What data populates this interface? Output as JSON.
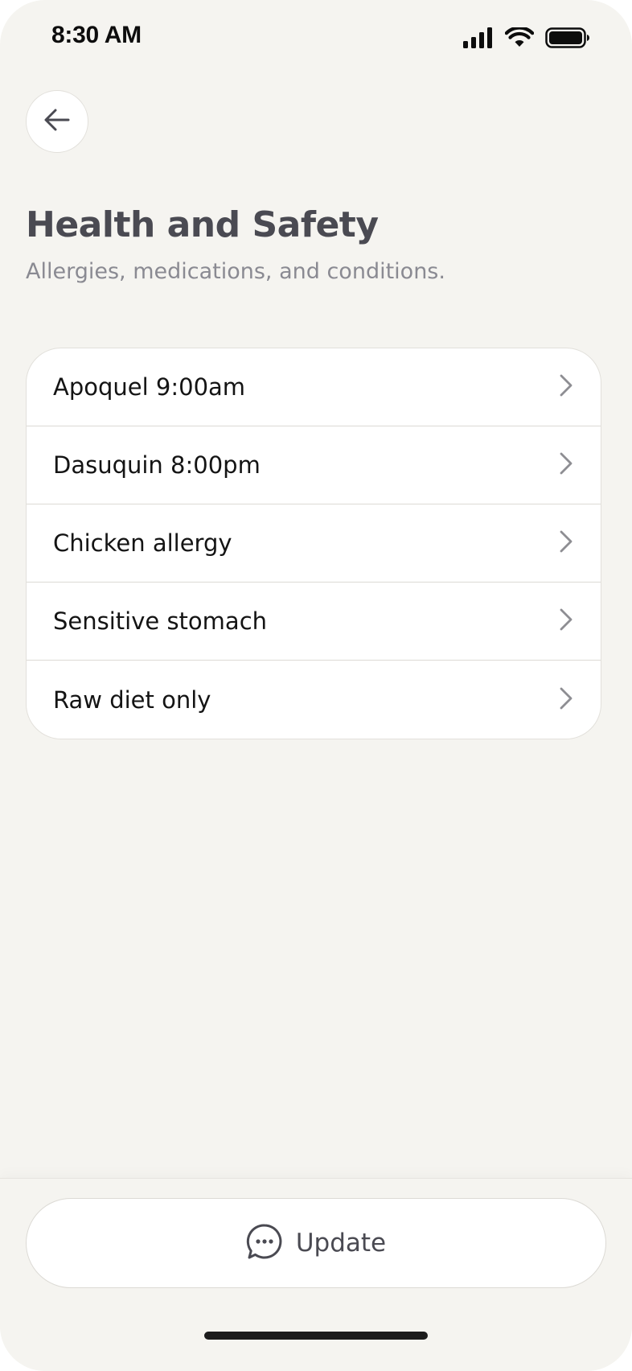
{
  "status_bar": {
    "time": "8:30 AM",
    "icons": [
      "signal-icon",
      "wifi-icon",
      "battery-icon"
    ]
  },
  "header": {
    "back_icon": "arrow-left-icon",
    "title": "Health and Safety",
    "subtitle": "Allergies, medications, and conditions."
  },
  "items": [
    {
      "label": "Apoquel 9:00am",
      "icon": "chevron-right-icon"
    },
    {
      "label": "Dasuquin 8:00pm",
      "icon": "chevron-right-icon"
    },
    {
      "label": "Chicken allergy",
      "icon": "chevron-right-icon"
    },
    {
      "label": "Sensitive stomach",
      "icon": "chevron-right-icon"
    },
    {
      "label": "Raw diet only",
      "icon": "chevron-right-icon"
    }
  ],
  "footer": {
    "update_label": "Update",
    "update_icon": "chat-bubble-icon"
  },
  "colors": {
    "background": "#f5f4f0",
    "card": "#ffffff",
    "title": "#4a4a52",
    "subtitle": "#8a8a92",
    "chevron": "#8e8e93"
  }
}
